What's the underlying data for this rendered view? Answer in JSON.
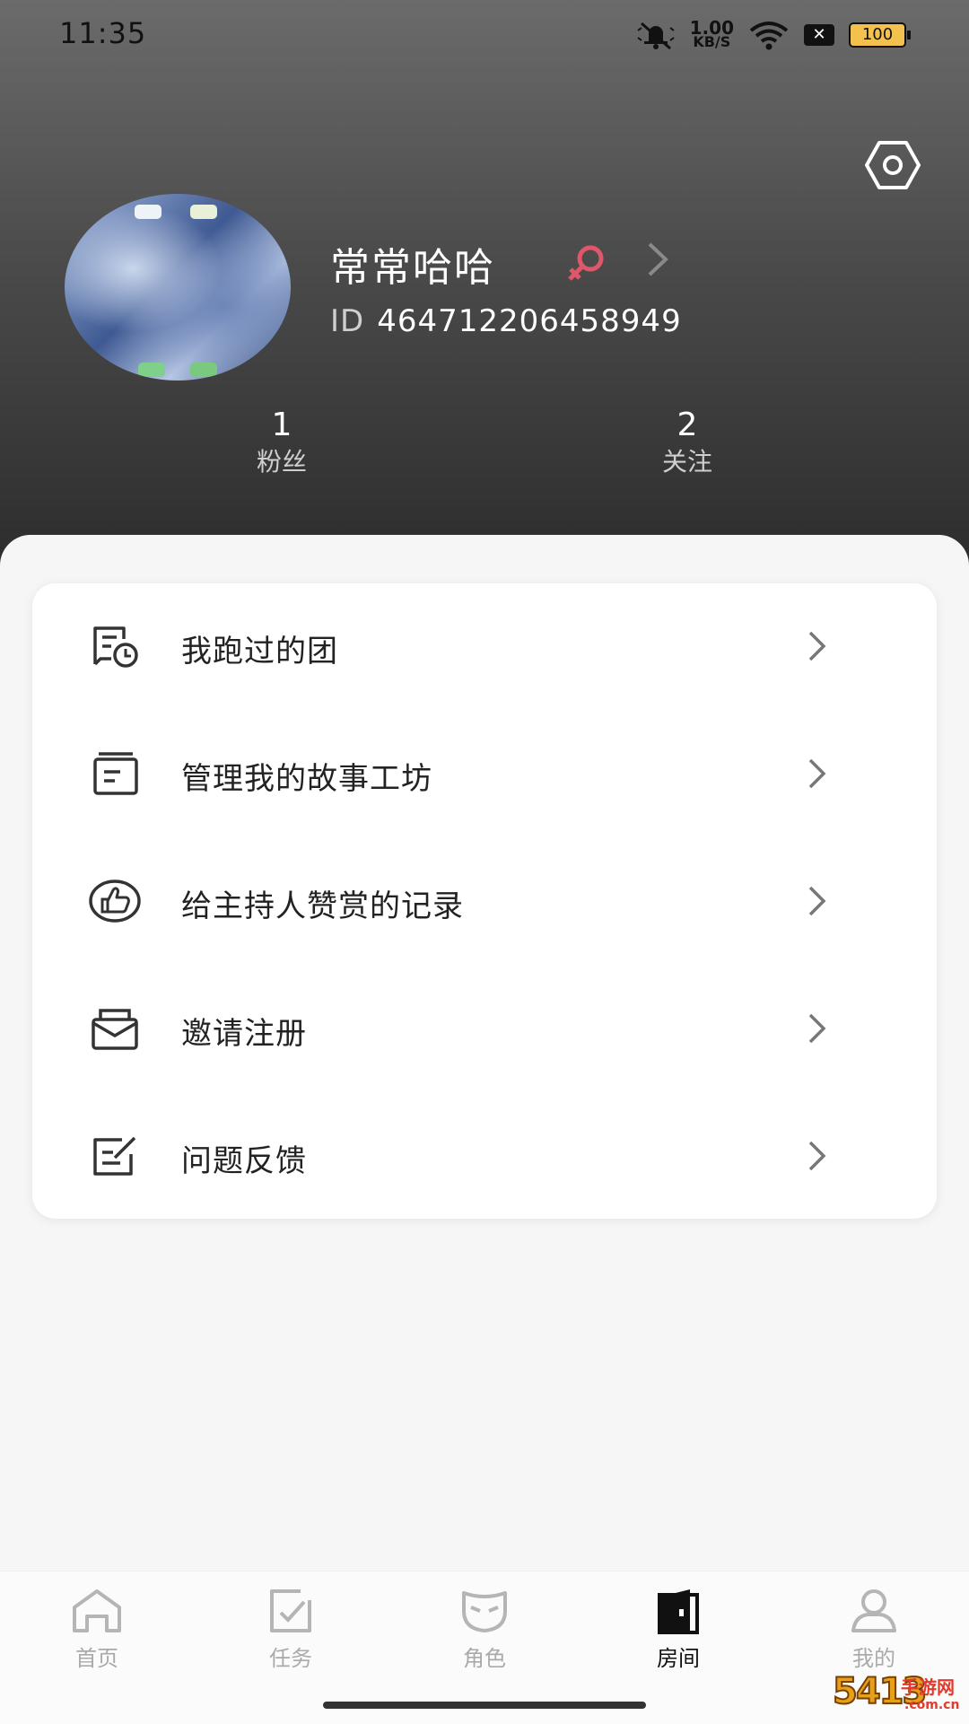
{
  "status_bar": {
    "time": "11:35",
    "net_speed_value": "1.00",
    "net_speed_unit": "KB/S",
    "battery": "100",
    "icons": [
      "mute-bell-icon",
      "wifi-icon",
      "sim-off-icon",
      "battery-icon"
    ]
  },
  "profile": {
    "nickname": "常常哈哈",
    "gender_icon": "female-icon",
    "id_prefix": "ID",
    "id_value": "464712206458949",
    "fans_count": "1",
    "fans_label": "粉丝",
    "follow_count": "2",
    "follow_label": "关注"
  },
  "menu": {
    "items": [
      {
        "label": "我跑过的团",
        "icon": "group-history-icon"
      },
      {
        "label": "管理我的故事工坊",
        "icon": "story-workshop-icon"
      },
      {
        "label": "给主持人赞赏的记录",
        "icon": "thumbs-up-icon"
      },
      {
        "label": "邀请注册",
        "icon": "invite-mail-icon"
      },
      {
        "label": "问题反馈",
        "icon": "feedback-edit-icon"
      }
    ]
  },
  "bottom_nav": {
    "items": [
      {
        "label": "首页",
        "icon": "home-icon"
      },
      {
        "label": "任务",
        "icon": "task-icon"
      },
      {
        "label": "角色",
        "icon": "mask-icon"
      },
      {
        "label": "房间",
        "icon": "door-icon"
      },
      {
        "label": "我的",
        "icon": "person-icon"
      }
    ],
    "active": "房间"
  },
  "watermark": {
    "main": "5413",
    "sub": "手游网",
    "domain": ".com.cn"
  },
  "colors": {
    "header_top": "#6b6b6b",
    "header_bottom": "#2c2c2c",
    "female_accent": "#e0566a",
    "nav_inactive": "#aaaaaa",
    "nav_active": "#111111"
  }
}
